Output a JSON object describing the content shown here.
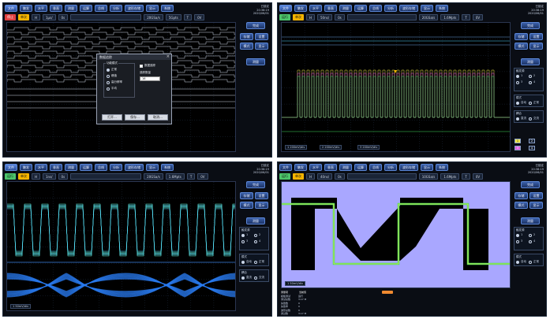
{
  "menus": [
    {
      "items": [
        "文件",
        "触发",
        "水平",
        "垂直",
        "测量",
        "运算",
        "总线",
        "分析",
        "波形存储",
        "显示",
        "系统"
      ],
      "active": 0
    },
    {
      "items": [
        "文件",
        "触发",
        "水平",
        "垂直",
        "测量",
        "运算",
        "总线",
        "分析",
        "波形存储",
        "显示",
        "系统"
      ],
      "active": 0
    },
    {
      "items": [
        "文件",
        "触发",
        "水平",
        "垂直",
        "测量",
        "运算",
        "总线",
        "分析",
        "波形存储",
        "显示",
        "系统"
      ],
      "active": 0
    },
    {
      "items": [
        "文件",
        "触发",
        "水平",
        "垂直",
        "测量",
        "运算",
        "总线",
        "分析",
        "波形存储",
        "显示",
        "系统"
      ],
      "active": -1
    }
  ],
  "status": [
    {
      "run": "停止",
      "single": "单次",
      "h": "H",
      "timebase": "1μs/",
      "delay": "0s",
      "mode": "",
      "sample": "20GSa/s",
      "mem": "5Gpts",
      "trig": "T",
      "level": "0V"
    },
    {
      "run": "运行",
      "single": "单次",
      "h": "H",
      "timebase": "50ns/",
      "delay": "0s",
      "mode": "",
      "sample": "20GSa/s",
      "mem": "1.6Mpts",
      "trig": "T",
      "level": "0V"
    },
    {
      "run": "运行",
      "single": "单次",
      "h": "H",
      "timebase": "1ns/",
      "delay": "0s",
      "mode": "",
      "sample": "20GSa/s",
      "mem": "1.6Mpts",
      "trig": "T",
      "level": "0V"
    },
    {
      "run": "运行",
      "single": "单次",
      "h": "H",
      "timebase": "40ns/",
      "delay": "0s",
      "mode": "",
      "sample": "10GSa/s",
      "mem": "1.6Mpts",
      "trig": "T",
      "level": "0V"
    }
  ],
  "clocks": [
    {
      "label": "已锁定",
      "time": "20:38:19",
      "date": "2020/06/01"
    },
    {
      "label": "已锁定",
      "time": "20:38:19",
      "date": "2020/06/01"
    },
    {
      "label": "已锁定",
      "time": "20:38:19",
      "date": "2020/06/01"
    },
    {
      "label": "已锁定",
      "time": "20:38:19",
      "date": "2020/06/01"
    }
  ],
  "dialog": {
    "title": "数据追踪",
    "group_label": "功能模式",
    "options": [
      "正常",
      "峰值",
      "高分辨率",
      "平均"
    ],
    "checkbox_label": "数据追踪",
    "select_label": "追踪数量",
    "select_value": "16",
    "buttons": [
      "打开...",
      "保存...",
      "取消..."
    ]
  },
  "sidebar_p1": {
    "buttons": [
      "完成",
      "存储",
      "设置",
      "模式",
      "显示"
    ],
    "footer": "测量"
  },
  "sidebar_p2": {
    "buttons": [
      "完成",
      "存储",
      "设置",
      "模式",
      "显示",
      "测量"
    ],
    "section1": "触发源",
    "sources": [
      "1",
      "2",
      "3",
      "4"
    ],
    "section2": "模式",
    "modes": [
      "自动",
      "正常"
    ],
    "section3": "耦合",
    "couplings": [
      "直流",
      "交流"
    ],
    "channels": [
      "1",
      "2",
      "3",
      "4"
    ]
  },
  "sidebar_p3": {
    "buttons": [
      "完成",
      "存储",
      "设置",
      "模式",
      "显示",
      "测量"
    ],
    "section1": "触发源",
    "sources": [
      "1",
      "2",
      "3",
      "4"
    ],
    "section2": "模式",
    "modes": [
      "自动",
      "正常"
    ],
    "section3": "耦合",
    "couplings": [
      "直流",
      "交流"
    ]
  },
  "sidebar_p4": {
    "buttons": [
      "完成",
      "存储",
      "设置",
      "模式",
      "显示",
      "测量"
    ],
    "section1": "触发源",
    "sources": [
      "1",
      "2",
      "3",
      "4"
    ],
    "section2": "模式",
    "modes": [
      "自动",
      "正常"
    ]
  },
  "bottom_p2": [
    "1  200mV/div",
    "2  200mV/div",
    "3  200mV/div"
  ],
  "bottom_p3": [
    "1  50mV/div"
  ],
  "bottom_p4": [
    "1  50mV/div"
  ],
  "meas_p4": {
    "header": [
      "测量项",
      "当前值"
    ],
    "rows": [
      [
        "模板测试",
        "运行"
      ],
      [
        "测试总数",
        "3.17 M"
      ],
      [
        "失败数",
        "0"
      ],
      [
        "失败率",
        "0"
      ],
      [
        "波形总数",
        "0"
      ],
      [
        "通过数",
        "3.17 M"
      ]
    ]
  },
  "colors": {
    "accent": "#3a5fa8",
    "ch1": "#f0e64a",
    "ch2": "#4fd4ff",
    "ch3": "#e060e0",
    "ch4": "#40e060",
    "mask": "#a9a7ff"
  }
}
